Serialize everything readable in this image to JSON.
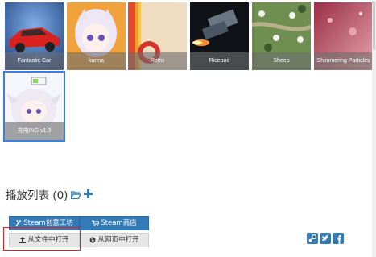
{
  "workshop": {
    "items": [
      {
        "label": "Fantastic Car"
      },
      {
        "label": "kanna"
      },
      {
        "label": "Retro"
      },
      {
        "label": "Ricepod"
      },
      {
        "label": "Sheep"
      },
      {
        "label": "Shimmering Particles"
      },
      {
        "label": "充电ING v1.3"
      }
    ]
  },
  "playlist": {
    "title": "播放列表",
    "count": "(0)",
    "folder_icon": "folder-open-icon",
    "add_icon": "plus-icon"
  },
  "buttons": {
    "workshop": "Steam创意工坊",
    "store": "Steam商店",
    "open_file": "从文件中打开",
    "open_web": "从网页中打开"
  },
  "social": [
    "steam-icon",
    "twitter-icon",
    "facebook-icon"
  ],
  "colors": {
    "primary_button": "#337ab7",
    "secondary_button": "#e6e6e6",
    "icon_blue": "#337ab7",
    "highlight_border": "#e02020",
    "selected_border": "#3d7ddb"
  }
}
